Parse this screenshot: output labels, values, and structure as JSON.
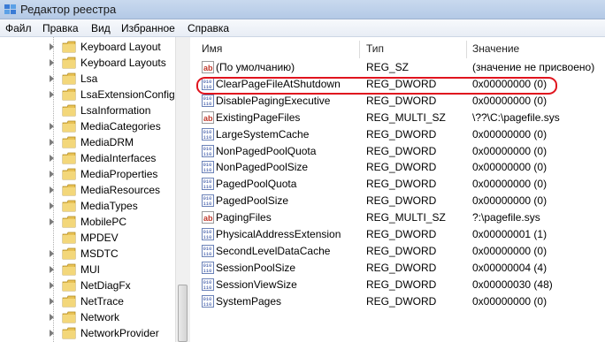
{
  "window": {
    "title": "Редактор реестра"
  },
  "menu": [
    {
      "label": "Файл"
    },
    {
      "label": "Правка"
    },
    {
      "label": "Вид"
    },
    {
      "label": "Избранное"
    },
    {
      "label": "Справка"
    }
  ],
  "tree": {
    "items": [
      {
        "label": "Keyboard Layout",
        "expandable": true
      },
      {
        "label": "Keyboard Layouts",
        "expandable": true
      },
      {
        "label": "Lsa",
        "expandable": true
      },
      {
        "label": "LsaExtensionConfig",
        "expandable": true
      },
      {
        "label": "LsaInformation",
        "expandable": false
      },
      {
        "label": "MediaCategories",
        "expandable": true
      },
      {
        "label": "MediaDRM",
        "expandable": true
      },
      {
        "label": "MediaInterfaces",
        "expandable": true
      },
      {
        "label": "MediaProperties",
        "expandable": true
      },
      {
        "label": "MediaResources",
        "expandable": true
      },
      {
        "label": "MediaTypes",
        "expandable": true
      },
      {
        "label": "MobilePC",
        "expandable": true
      },
      {
        "label": "MPDEV",
        "expandable": false
      },
      {
        "label": "MSDTC",
        "expandable": true
      },
      {
        "label": "MUI",
        "expandable": true
      },
      {
        "label": "NetDiagFx",
        "expandable": true
      },
      {
        "label": "NetTrace",
        "expandable": true
      },
      {
        "label": "Network",
        "expandable": true
      },
      {
        "label": "NetworkProvider",
        "expandable": true
      }
    ]
  },
  "columns": {
    "name": "Имя",
    "type": "Тип",
    "value": "Значение"
  },
  "values": [
    {
      "icon": "string-value-icon",
      "name": "(По умолчанию)",
      "type": "REG_SZ",
      "data": "(значение не присвоено)"
    },
    {
      "icon": "binary-value-icon",
      "name": "ClearPageFileAtShutdown",
      "type": "REG_DWORD",
      "data": "0x00000000 (0)"
    },
    {
      "icon": "binary-value-icon",
      "name": "DisablePagingExecutive",
      "type": "REG_DWORD",
      "data": "0x00000000 (0)"
    },
    {
      "icon": "string-value-icon",
      "name": "ExistingPageFiles",
      "type": "REG_MULTI_SZ",
      "data": "\\??\\C:\\pagefile.sys"
    },
    {
      "icon": "binary-value-icon",
      "name": "LargeSystemCache",
      "type": "REG_DWORD",
      "data": "0x00000000 (0)"
    },
    {
      "icon": "binary-value-icon",
      "name": "NonPagedPoolQuota",
      "type": "REG_DWORD",
      "data": "0x00000000 (0)"
    },
    {
      "icon": "binary-value-icon",
      "name": "NonPagedPoolSize",
      "type": "REG_DWORD",
      "data": "0x00000000 (0)"
    },
    {
      "icon": "binary-value-icon",
      "name": "PagedPoolQuota",
      "type": "REG_DWORD",
      "data": "0x00000000 (0)"
    },
    {
      "icon": "binary-value-icon",
      "name": "PagedPoolSize",
      "type": "REG_DWORD",
      "data": "0x00000000 (0)"
    },
    {
      "icon": "string-value-icon",
      "name": "PagingFiles",
      "type": "REG_MULTI_SZ",
      "data": "?:\\pagefile.sys"
    },
    {
      "icon": "binary-value-icon",
      "name": "PhysicalAddressExtension",
      "type": "REG_DWORD",
      "data": "0x00000001 (1)"
    },
    {
      "icon": "binary-value-icon",
      "name": "SecondLevelDataCache",
      "type": "REG_DWORD",
      "data": "0x00000000 (0)"
    },
    {
      "icon": "binary-value-icon",
      "name": "SessionPoolSize",
      "type": "REG_DWORD",
      "data": "0x00000004 (4)"
    },
    {
      "icon": "binary-value-icon",
      "name": "SessionViewSize",
      "type": "REG_DWORD",
      "data": "0x00000030 (48)"
    },
    {
      "icon": "binary-value-icon",
      "name": "SystemPages",
      "type": "REG_DWORD",
      "data": "0x00000000 (0)"
    }
  ],
  "colors": {
    "highlight": "#e0141e",
    "folder": "#e8c154"
  }
}
